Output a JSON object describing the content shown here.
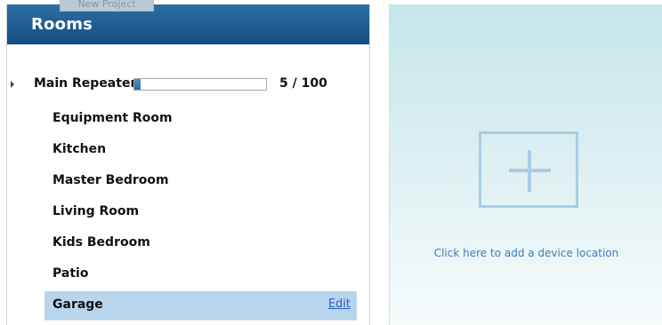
{
  "rooms_panel": {
    "ghost_tab_label": "New Project",
    "title": "Rooms",
    "repeater": {
      "label": "Main Repeater",
      "capacity_used": 5,
      "capacity_total": 100,
      "capacity_text": "5 / 100"
    },
    "rooms": [
      {
        "label": "Equipment Room"
      },
      {
        "label": "Kitchen"
      },
      {
        "label": "Master Bedroom"
      },
      {
        "label": "Living Room"
      },
      {
        "label": "Kids Bedroom"
      },
      {
        "label": "Patio"
      },
      {
        "label": "Garage",
        "selected": true,
        "edit_label": "Edit"
      }
    ]
  },
  "device_panel": {
    "add_hint": "Click here to add a device location",
    "add_icon": "plus-icon"
  },
  "colors": {
    "header_blue": "#1d5a8f",
    "selected_row": "#b9d5ec",
    "link_blue": "#2a63c4",
    "tile_blue": "#a9cde4"
  }
}
